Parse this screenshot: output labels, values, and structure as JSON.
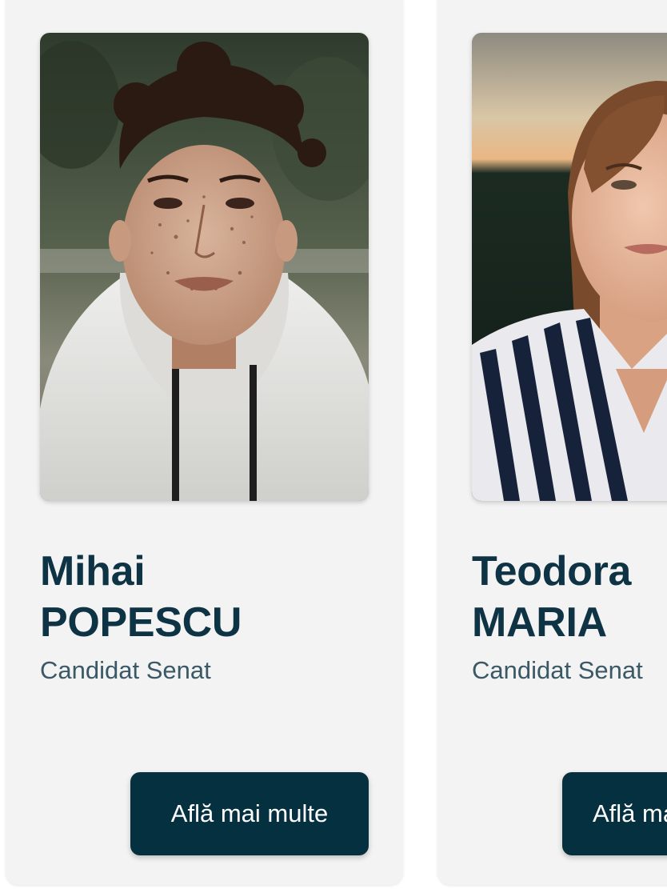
{
  "candidates": [
    {
      "first_name": "Mihai",
      "last_name": "POPESCU",
      "role": "Candidat Senat",
      "cta_label": "Află mai multe",
      "photo_alt": "portrait-photo-mihai"
    },
    {
      "first_name": "Teodora",
      "last_name": "MARIA",
      "role": "Candidat Senat",
      "cta_label": "Află mai multe",
      "photo_alt": "portrait-photo-teodora"
    }
  ],
  "colors": {
    "card_bg": "#f3f3f3",
    "name_text": "#0d3344",
    "role_text": "#3b5866",
    "button_bg": "#05303f",
    "button_text": "#ffffff"
  }
}
